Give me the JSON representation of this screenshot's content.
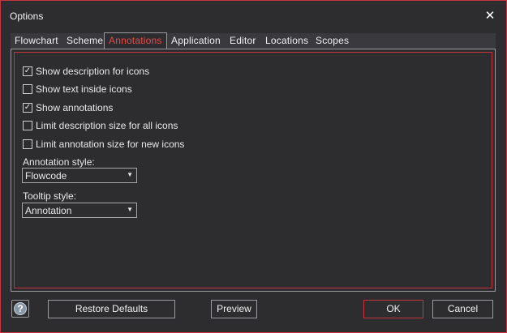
{
  "window": {
    "title": "Options",
    "close_glyph": "✕"
  },
  "tabs": [
    {
      "label": "Flowchart",
      "active": false
    },
    {
      "label": "Scheme",
      "active": false
    },
    {
      "label": "Annotations",
      "active": true
    },
    {
      "label": "Application",
      "active": false
    },
    {
      "label": "Editor",
      "active": false
    },
    {
      "label": "Locations",
      "active": false
    },
    {
      "label": "Scopes",
      "active": false
    }
  ],
  "annotations": {
    "checkboxes": [
      {
        "label": "Show description for icons",
        "checked": true
      },
      {
        "label": "Show text inside icons",
        "checked": false
      },
      {
        "label": "Show annotations",
        "checked": true
      },
      {
        "label": "Limit description size for all icons",
        "checked": false
      },
      {
        "label": "Limit annotation size for new icons",
        "checked": false
      }
    ],
    "annotation_style": {
      "label": "Annotation style:",
      "value": "Flowcode"
    },
    "tooltip_style": {
      "label": "Tooltip style:",
      "value": "Annotation"
    }
  },
  "buttons": {
    "help": "?",
    "restore_defaults": "Restore Defaults",
    "preview": "Preview",
    "ok": "OK",
    "cancel": "Cancel"
  },
  "icons": {
    "close": "close-icon",
    "help": "help-icon",
    "dropdown": "chevron-down-icon",
    "check": "check-icon"
  },
  "colors": {
    "accent": "#c8323c",
    "active_tab_text": "#e64848",
    "background": "#2d2d30",
    "tabstrip": "#3a3a3e"
  }
}
